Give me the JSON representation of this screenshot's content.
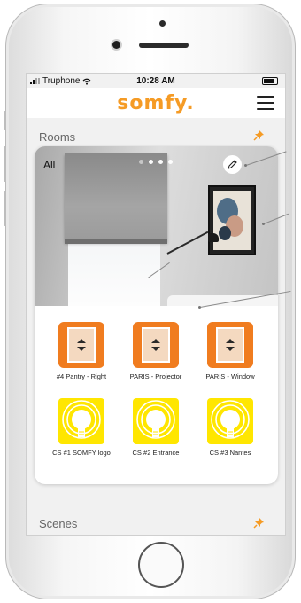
{
  "status_bar": {
    "carrier": "Truphone",
    "time": "10:28 AM"
  },
  "app": {
    "logo": "somfy."
  },
  "sections": {
    "rooms_label": "Rooms",
    "scenes_label": "Scenes"
  },
  "room_card": {
    "filter_label": "All",
    "carousel_pages": 4
  },
  "devices": [
    {
      "label": "#4 Pantry - Right",
      "type": "shutter"
    },
    {
      "label": "PARIS - Projector",
      "type": "shutter"
    },
    {
      "label": "PARIS - Window",
      "type": "shutter"
    },
    {
      "label": "CS #1 SOMFY logo",
      "type": "light"
    },
    {
      "label": "CS #2 Entrance",
      "type": "light"
    },
    {
      "label": "CS #3 Nantes",
      "type": "light"
    }
  ],
  "icons": {
    "menu": "hamburger-icon",
    "pin": "pin-icon",
    "edit": "pencil-icon",
    "shutter": "shutter-icon",
    "light": "lightbulb-icon",
    "wifi": "wifi-icon",
    "battery": "battery-icon"
  },
  "colors": {
    "brand": "#f59b25",
    "shutter_tile": "#f07c1f",
    "light_tile": "#ffe600"
  }
}
